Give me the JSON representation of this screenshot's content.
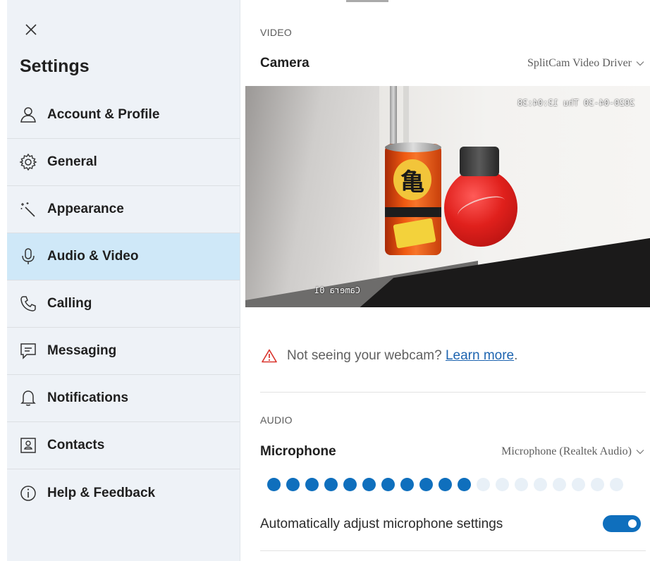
{
  "sidebar": {
    "title": "Settings",
    "close_icon": "close-icon",
    "items": [
      {
        "label": "Account & Profile",
        "icon": "person-icon",
        "active": false
      },
      {
        "label": "General",
        "icon": "gear-icon",
        "active": false
      },
      {
        "label": "Appearance",
        "icon": "magic-wand-icon",
        "active": false
      },
      {
        "label": "Audio & Video",
        "icon": "microphone-icon",
        "active": true
      },
      {
        "label": "Calling",
        "icon": "phone-icon",
        "active": false
      },
      {
        "label": "Messaging",
        "icon": "chat-icon",
        "active": false
      },
      {
        "label": "Notifications",
        "icon": "bell-icon",
        "active": false
      },
      {
        "label": "Contacts",
        "icon": "contact-card-icon",
        "active": false
      },
      {
        "label": "Help & Feedback",
        "icon": "info-icon",
        "active": false
      }
    ]
  },
  "video": {
    "section_label": "VIDEO",
    "camera_label": "Camera",
    "camera_device": "SplitCam Video Driver",
    "preview_timestamp": "2020-04-30 Thu 13:04:38",
    "preview_camera_name": "Camera 01",
    "help_text": "Not seeing your webcam? ",
    "help_link": "Learn more",
    "help_suffix": "."
  },
  "audio": {
    "section_label": "AUDIO",
    "microphone_label": "Microphone",
    "microphone_device": "Microphone (Realtek Audio)",
    "mic_level_active": 11,
    "mic_level_total": 19,
    "auto_adjust_label": "Automatically adjust microphone settings",
    "auto_adjust_enabled": true
  },
  "colors": {
    "accent": "#0f6fbd",
    "active_nav": "#cfe8f8",
    "sidebar_bg": "#eef2f7",
    "warning": "#d9332c",
    "link": "#1d64b0"
  }
}
